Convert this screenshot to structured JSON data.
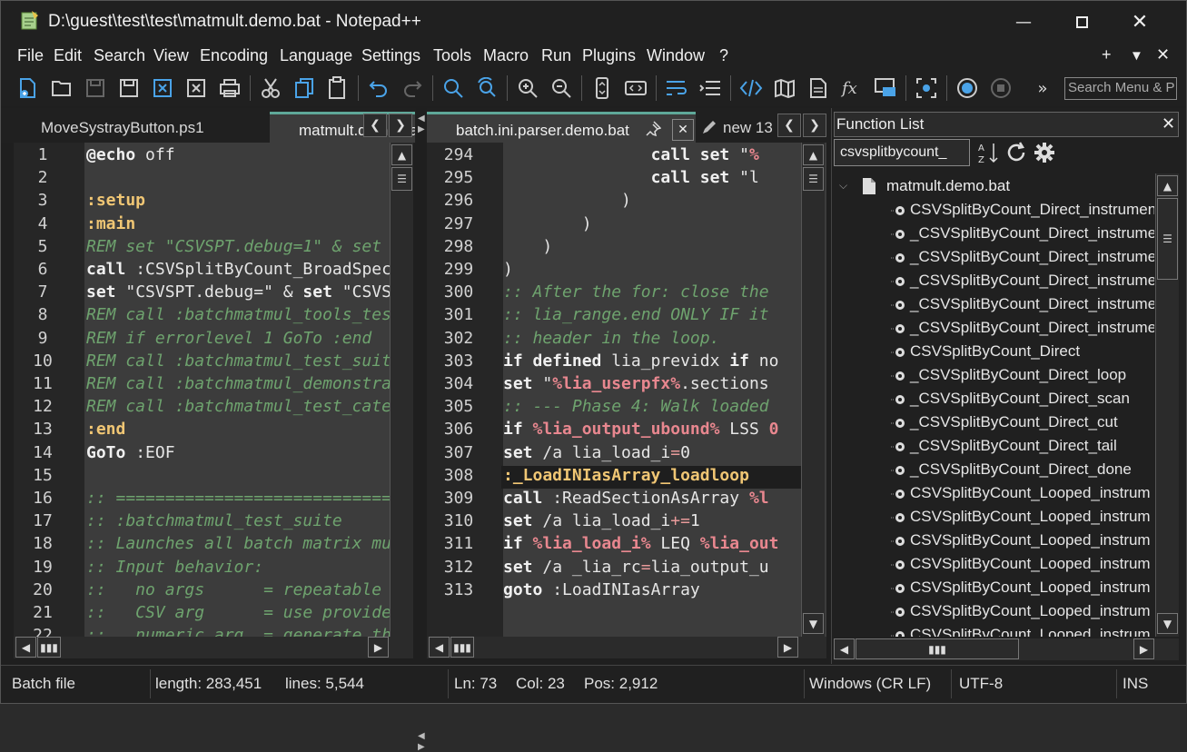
{
  "window": {
    "title": "D:\\guest\\test\\test\\matmult.demo.bat - Notepad++"
  },
  "menu": [
    "File",
    "Edit",
    "Search",
    "View",
    "Encoding",
    "Language",
    "Settings",
    "Tools",
    "Macro",
    "Run",
    "Plugins",
    "Window",
    "?"
  ],
  "menu_right": [
    "+",
    "▼",
    "✕"
  ],
  "toolbar": {
    "overflow": "»",
    "search_placeholder": "Search Menu & P"
  },
  "left_view": {
    "tabs": [
      "MoveSystrayButton.ps1",
      "matmult.demo.bat"
    ],
    "lines": [
      {
        "n": "1",
        "html": "<span class='kw'>@echo</span> off"
      },
      {
        "n": "2",
        "html": ""
      },
      {
        "n": "3",
        "html": "<span class='lbl'>:setup</span>"
      },
      {
        "n": "4",
        "html": "<span class='lbl'>:main</span>"
      },
      {
        "n": "5",
        "html": "<span class='cm'>REM set \"CSVSPT.debug=1\" &amp; set</span>"
      },
      {
        "n": "6",
        "html": "<span class='kw'>call</span> :CSVSplitByCount_BroadSpec"
      },
      {
        "n": "7",
        "html": "<span class='kw'>set</span> \"CSVSPT.debug=\" &amp; <span class='kw'>set</span> \"CSVS"
      },
      {
        "n": "8",
        "html": "<span class='cm'>REM call :batchmatmul_tools_tes</span>"
      },
      {
        "n": "9",
        "html": "<span class='cm'>REM if errorlevel 1 GoTo :end</span>"
      },
      {
        "n": "10",
        "html": "<span class='cm'>REM call :batchmatmul_test_suit</span>"
      },
      {
        "n": "11",
        "html": "<span class='cm'>REM call :batchmatmul_demonstra</span>"
      },
      {
        "n": "12",
        "html": "<span class='cm'>REM call :batchmatmul_test_cate</span>"
      },
      {
        "n": "13",
        "html": "<span class='lbl'>:end</span>"
      },
      {
        "n": "14",
        "html": "<span class='kw'>GoTo</span> :EOF"
      },
      {
        "n": "15",
        "html": ""
      },
      {
        "n": "16",
        "html": "<span class='cm'>:: ===============================</span>"
      },
      {
        "n": "17",
        "html": "<span class='cm'>:: :batchmatmul_test_suite</span>"
      },
      {
        "n": "18",
        "html": "<span class='cm'>:: Launches all batch matrix mu</span>"
      },
      {
        "n": "19",
        "html": "<span class='cm'>:: Input behavior:</span>"
      },
      {
        "n": "20",
        "html": "<span class='cm'>::   no args      = repeatable</span>"
      },
      {
        "n": "21",
        "html": "<span class='cm'>::   CSV arg      = use provide</span>"
      },
      {
        "n": "22",
        "html": "<span class='cm'>::   numeric arg  = generate th</span>"
      }
    ]
  },
  "right_view": {
    "tabs": [
      "batch.ini.parser.demo.bat",
      "new 13"
    ],
    "lines": [
      {
        "n": "294",
        "html": "               <span class='kw'>call set</span> \"<span class='var'>%</span>"
      },
      {
        "n": "295",
        "html": "               <span class='kw'>call set</span> \"l"
      },
      {
        "n": "296",
        "html": "            )"
      },
      {
        "n": "297",
        "html": "        )"
      },
      {
        "n": "298",
        "html": "    )"
      },
      {
        "n": "299",
        "html": ")"
      },
      {
        "n": "300",
        "html": "<span class='cm'>:: After the for: close the</span>"
      },
      {
        "n": "301",
        "html": "<span class='cm'>:: lia_range.end ONLY IF it</span>"
      },
      {
        "n": "302",
        "html": "<span class='cm'>:: header in the loop.</span>"
      },
      {
        "n": "303",
        "html": "<span class='kw'>if defined</span> lia_previdx <span class='kw'>if</span> no"
      },
      {
        "n": "304",
        "html": "<span class='kw'>set</span> \"<span class='var'>%lia_userpfx%</span>.sections"
      },
      {
        "n": "305",
        "html": "<span class='cm'>:: --- Phase 4: Walk loaded</span>"
      },
      {
        "n": "306",
        "html": "<span class='kw'>if</span> <span class='var'>%lia_output_ubound%</span> LSS <span class='var'>0</span>"
      },
      {
        "n": "307",
        "html": "<span class='kw'>set</span> /a lia_load_i<span class='op'>=</span>0"
      },
      {
        "n": "308",
        "html": "<span class='lbl'>:_LoadINIasArray_loadloop</span>"
      },
      {
        "n": "309",
        "html": "<span class='kw'>call</span> :ReadSectionAsArray <span class='var'>%l</span>"
      },
      {
        "n": "310",
        "html": "<span class='kw'>set</span> /a lia_load_i<span class='op'>+=</span>1"
      },
      {
        "n": "311",
        "html": "<span class='kw'>if</span> <span class='var'>%lia_load_i%</span> LEQ <span class='var'>%lia_out</span>"
      },
      {
        "n": "312",
        "html": "<span class='kw'>set</span> /a _lia_rc<span class='op'>=</span>lia_output_u"
      },
      {
        "n": "313",
        "html": "<span class='kw'>goto</span> :LoadINIasArray"
      }
    ]
  },
  "function_list": {
    "title": "Function List",
    "search_value": "csvsplitbycount_",
    "root": "matmult.demo.bat",
    "items": [
      "CSVSplitByCount_Direct_instrumen",
      "_CSVSplitByCount_Direct_instrume",
      "_CSVSplitByCount_Direct_instrume",
      "_CSVSplitByCount_Direct_instrume",
      "_CSVSplitByCount_Direct_instrume",
      "_CSVSplitByCount_Direct_instrume",
      "CSVSplitByCount_Direct",
      "_CSVSplitByCount_Direct_loop",
      "_CSVSplitByCount_Direct_scan",
      "_CSVSplitByCount_Direct_cut",
      "_CSVSplitByCount_Direct_tail",
      "_CSVSplitByCount_Direct_done",
      "CSVSplitByCount_Looped_instrum",
      "CSVSplitByCount_Looped_instrum",
      "CSVSplitByCount_Looped_instrum",
      "CSVSplitByCount_Looped_instrum",
      "CSVSplitByCount_Looped_instrum",
      "CSVSplitByCount_Looped_instrum",
      "CSVSplitByCount_Looped_instrum"
    ]
  },
  "status": {
    "type": "Batch file",
    "length": "length: 283,451",
    "lines": "lines: 5,544",
    "ln": "Ln: 73",
    "col": "Col: 23",
    "pos": "Pos: 2,912",
    "eol": "Windows (CR LF)",
    "encoding": "UTF-8",
    "mode": "INS"
  },
  "colors": {
    "accent_tab": "#5fa899",
    "editor_bg": "#3c3c3c",
    "comment": "#6ea36e",
    "label": "#f0c674",
    "variable": "#e8878f"
  }
}
